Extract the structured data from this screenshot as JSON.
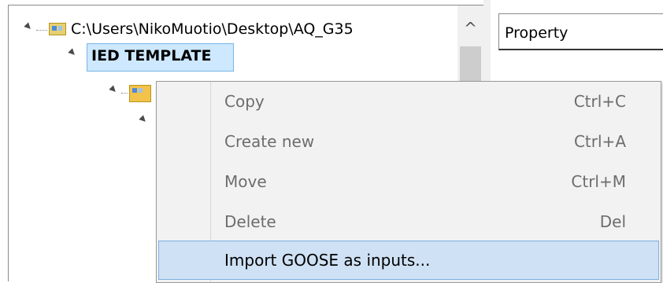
{
  "tree": {
    "root_path": "C:\\Users\\NikoMuotio\\Desktop\\AQ_G35",
    "child_label": "IED TEMPLATE",
    "scroll_up_glyph": "^"
  },
  "properties": {
    "header": "Property"
  },
  "context_menu": {
    "items": [
      {
        "label": "Copy",
        "shortcut": "Ctrl+C",
        "enabled": false
      },
      {
        "label": "Create new",
        "shortcut": "Ctrl+A",
        "enabled": false
      },
      {
        "label": "Move",
        "shortcut": "Ctrl+M",
        "enabled": false
      },
      {
        "label": "Delete",
        "shortcut": "Del",
        "enabled": false
      },
      {
        "label": "Import GOOSE as inputs...",
        "shortcut": "",
        "enabled": true,
        "highlighted": true
      }
    ]
  },
  "icons": [
    "expand-triangle-icon",
    "scl-file-icon",
    "scl-node-icon"
  ],
  "colors": {
    "selection_bg": "#cde8ff",
    "selection_border": "#7ab5e6",
    "menu_hover_bg": "#cfe1f4",
    "menu_hover_border": "#7eb0e0",
    "disabled_text": "#6d6d6d"
  }
}
